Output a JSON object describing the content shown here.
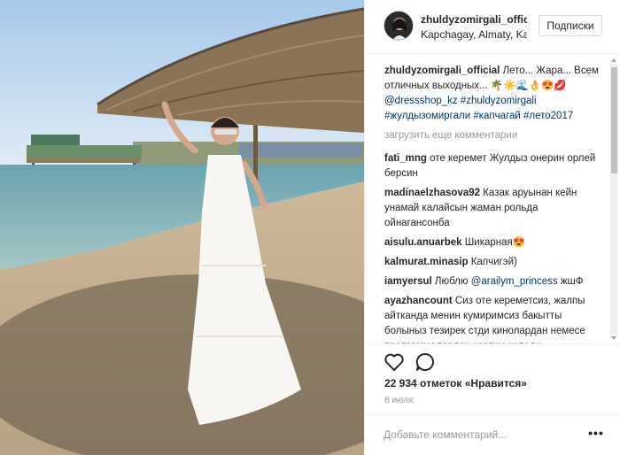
{
  "header": {
    "username": "zhuldyzomirgali_official",
    "location": "Kapchagay, Almaty, Kazakhstan",
    "follow_label": "Подписки",
    "avatar_icon": "user-avatar"
  },
  "caption": {
    "username": "zhuldyzomirgali_official",
    "text_line": "Лето... Жара... Всем отличных выходных... 🌴☀️🌊👌😍💋",
    "mention": "@dressshop_kz",
    "hashtags": [
      "#zhuldyzomirgali",
      "#жулдызомиргали",
      "#капчагай",
      "#лето2017"
    ]
  },
  "load_more_label": "загрузить еще комментарии",
  "comments": [
    {
      "user": "fati_mng",
      "text": "оте керемет Жулдыз онерин орлей берсин"
    },
    {
      "user": "madinaelzhasova92",
      "text": "Казак аруынан кейн унамай калайсын жаман рольда ойнагансонба"
    },
    {
      "user": "aisulu.anuarbek",
      "text": "Шикарная😍"
    },
    {
      "user": "kalmurat.minasip",
      "text": "Капчигэй)"
    },
    {
      "user": "iamyersul",
      "text": "Люблю",
      "mention": "@arailym_princess",
      "text_after": "жшФ"
    },
    {
      "user": "ayazhancount",
      "text": "Сиз оте кереметсиз, жалпы айтканда менин кумиримсиз бакытты болыныз тезирек стди кинолардан немесе программалардан коргим келеди"
    }
  ],
  "actions": {
    "like_icon": "heart-icon",
    "comment_icon": "comment-icon"
  },
  "likes_text": "22 934 отметок «Нравится»",
  "date_text": "8 июля",
  "add_comment_placeholder": "Добавьте комментарий...",
  "more_options_label": "•••",
  "colors": {
    "link": "#003569",
    "muted": "#999999",
    "border": "#efefef"
  }
}
